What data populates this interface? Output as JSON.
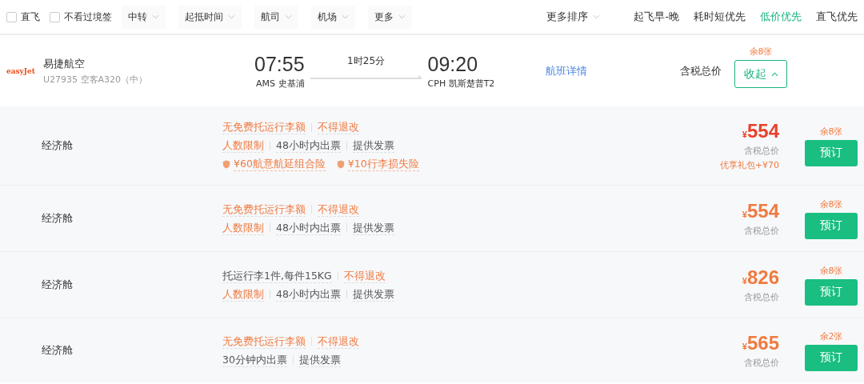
{
  "filters": {
    "checkboxes": [
      {
        "label": "直飞",
        "checked": false
      },
      {
        "label": "不看过境签",
        "checked": false
      }
    ],
    "dropdowns": [
      "中转",
      "起抵时间",
      "航司",
      "机场",
      "更多"
    ]
  },
  "sort": {
    "more_label": "更多排序",
    "options": [
      {
        "label": "起飞早-晚",
        "selected": false
      },
      {
        "label": "耗时短优先",
        "selected": false
      },
      {
        "label": "低价优先",
        "selected": true
      },
      {
        "label": "直飞优先",
        "selected": false
      }
    ]
  },
  "flight": {
    "logo": "easyJet",
    "airline": "易捷航空",
    "flight_info": "U27935 空客A320（中）",
    "depart_time": "07:55",
    "depart_airport": "AMS 史基浦",
    "duration": "1时25分",
    "arrive_time": "09:20",
    "arrive_airport": "CPH 凯斯楚普T2",
    "details_link": "航班详情",
    "price_label": "含税总价",
    "remaining": "余8张",
    "collapse_button": "收起",
    "expanded": true
  },
  "fares": [
    {
      "cabin": "经济舱",
      "lines": [
        [
          {
            "text": "无免费托运行李额",
            "kind": "warn"
          },
          {
            "text": "不得退改",
            "kind": "warn"
          }
        ],
        [
          {
            "text": "人数限制",
            "kind": "warn"
          },
          {
            "text": "48小时内出票",
            "kind": "plain"
          },
          {
            "text": "提供发票",
            "kind": "plain"
          }
        ],
        [
          {
            "text": "¥60航意航延组合险",
            "kind": "insurance"
          },
          {
            "text": "¥10行李损失险",
            "kind": "insurance"
          }
        ]
      ],
      "currency": "¥",
      "price": "554",
      "highlight": true,
      "price_note": "含税总价",
      "bonus": "优享礼包+¥70",
      "remaining": "余8张",
      "button": "预订"
    },
    {
      "cabin": "经济舱",
      "lines": [
        [
          {
            "text": "无免费托运行李额",
            "kind": "warn"
          },
          {
            "text": "不得退改",
            "kind": "warn"
          }
        ],
        [
          {
            "text": "人数限制",
            "kind": "warn"
          },
          {
            "text": "48小时内出票",
            "kind": "plain"
          },
          {
            "text": "提供发票",
            "kind": "plain"
          }
        ]
      ],
      "currency": "¥",
      "price": "554",
      "highlight": false,
      "price_note": "含税总价",
      "remaining": "余8张",
      "button": "预订"
    },
    {
      "cabin": "经济舱",
      "lines": [
        [
          {
            "text": "托运行李1件,每件15KG",
            "kind": "plain"
          },
          {
            "text": "不得退改",
            "kind": "warn"
          }
        ],
        [
          {
            "text": "人数限制",
            "kind": "warn"
          },
          {
            "text": "48小时内出票",
            "kind": "plain"
          },
          {
            "text": "提供发票",
            "kind": "plain"
          }
        ]
      ],
      "currency": "¥",
      "price": "826",
      "highlight": false,
      "price_note": "含税总价",
      "remaining": "余8张",
      "button": "预订"
    },
    {
      "cabin": "经济舱",
      "lines": [
        [
          {
            "text": "无免费托运行李额",
            "kind": "warn"
          },
          {
            "text": "不得退改",
            "kind": "warn"
          }
        ],
        [
          {
            "text": "30分钟内出票",
            "kind": "plain"
          },
          {
            "text": "提供发票",
            "kind": "plain"
          }
        ]
      ],
      "currency": "¥",
      "price": "565",
      "highlight": false,
      "price_note": "含税总价",
      "remaining": "余2张",
      "button": "预订"
    }
  ]
}
